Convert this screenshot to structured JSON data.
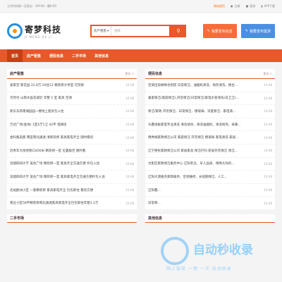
{
  "topbar": {
    "notice": "工作时间周一至周五：早9:00 - 晚6:00",
    "links": [
      "网站首页",
      "注册",
      "登录",
      "APP下载"
    ]
  },
  "header": {
    "logo_cn": "寄梦科技",
    "logo_en": "JI MENG KE JI",
    "search_category": "房产租售",
    "search_placeholder": "搜索",
    "post_button_1": "我要发布信息",
    "post_button_2": "我要发布需求"
  },
  "nav": {
    "items": [
      "首页",
      "房产租售",
      "便民信息",
      "二手市场",
      "其他信息"
    ]
  },
  "left_panel": {
    "title": "房产租售",
    "more": "更多 >",
    "items": [
      {
        "title": "爱家堂 家花园 22.8万 20往12 精装修大单室 可贷款",
        "date": "10-08"
      },
      {
        "title": "可月付 山南水晶花城近 年整 5 室 家具 空调",
        "date": "10-08"
      },
      {
        "title": "新东东新南湖园园一楼地上套房包入住",
        "date": "10-08"
      },
      {
        "title": "万达广场(金地) 1室1厅1卫 42平 电梯房",
        "date": "10-08"
      },
      {
        "title": "金科集美郡 两室南北通透 清新装修 家具家电齐全 随时看房",
        "date": "10-08"
      },
      {
        "title": "近青年大街地铁口400米 精装修一室 位置极佳 随时看",
        "date": "10-08"
      },
      {
        "title": "滨旭四四大学 美住广场 精装修一室 家具齐全交通方便 拎包入住",
        "date": "10-08"
      },
      {
        "title": "滨旭四四大学 美住广场 精装修一室 家具家电齐全交通方便拎包入住",
        "date": "10-08"
      },
      {
        "title": "北站欧洲小区 一套精装修 家具家电齐全 包包即住 看房方便",
        "date": "10-08"
      },
      {
        "title": "南庄小区58平精装修南北通透家具家电齐全包包即住年租1.1万",
        "date": "10-08"
      }
    ]
  },
  "right_panel": {
    "title": "便民信息",
    "more": "更多 >",
    "items": [
      {
        "title": "空调出现故障也别慌 日常保洁、油烟机清洗、地热清洗、换台...",
        "date": "10-08"
      },
      {
        "title": "桑家保洁(家庭保洁),开荒保洁(日常保洁)家电水管清洗(日卫卫)...",
        "date": "10-08"
      },
      {
        "title": "保洁/家政 开荒保洁、日常保洁、擦玻璃、深度保洁、家电清...",
        "date": "10-08"
      },
      {
        "title": "众鑫地板家电专业清洗 清洗地热、清洗油烟机、清洗地热、采暖...",
        "date": "10-08"
      },
      {
        "title": "傅秀娟家政保洁公司 家庭保洁 开荒保洁 擦玻璃 家电清洗 家居...",
        "date": "10-08"
      },
      {
        "title": "辽宁便民家政保洁公司 家居家具 保洁打扫 新居开荒保洁 清洁...",
        "date": "10-08"
      },
      {
        "title": "文影区家政保洁服务中心 辽阳老兵、军人品质、保障大局的...",
        "date": "10-08"
      },
      {
        "title": "辽阳大源服务家政服务、空调维修、长短期保洁、人工...",
        "date": "10-08"
      },
      {
        "title": "辽阳鑫...",
        "date": "10-08"
      },
      {
        "title": "日常保...",
        "date": "10-08"
      }
    ]
  },
  "bottom": {
    "left_title": "二手市场",
    "right_title": "其他信息"
  },
  "watermark": {
    "title": "自动秒收录",
    "subtitle": "网上链接 一键 一次 自动收录"
  },
  "colors": {
    "brand": "#e9572d",
    "nav_active": "#c93e17",
    "post_orange": "#f76c38",
    "post_blue": "#4a8fe2"
  }
}
